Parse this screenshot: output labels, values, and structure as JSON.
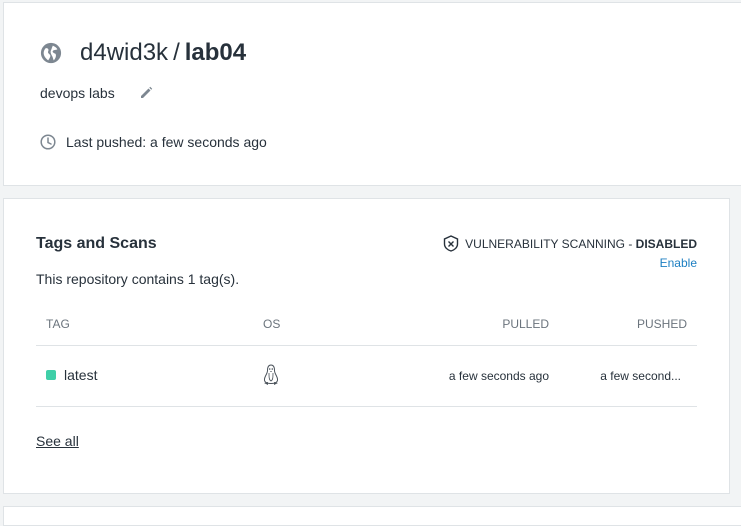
{
  "repo": {
    "namespace": "d4wid3k",
    "separator": "/",
    "name": "lab04",
    "description": "devops labs",
    "last_pushed": "Last pushed: a few seconds ago"
  },
  "tags_section": {
    "title": "Tags and Scans",
    "count_text": "This repository contains 1 tag(s).",
    "vuln_label": "VULNERABILITY SCANNING - ",
    "vuln_status": "DISABLED",
    "enable_link": "Enable",
    "columns": {
      "tag": "TAG",
      "os": "OS",
      "pulled": "PULLED",
      "pushed": "PUSHED"
    },
    "rows": [
      {
        "tag": "latest",
        "os_icon": "linux-icon",
        "pulled": "a few seconds ago",
        "pushed": "a few second..."
      }
    ],
    "see_all": "See all"
  },
  "colors": {
    "accent": "#1d7fc2",
    "tag_dot": "#3fcfa8",
    "text": "#27313b",
    "muted": "#6b747d"
  }
}
